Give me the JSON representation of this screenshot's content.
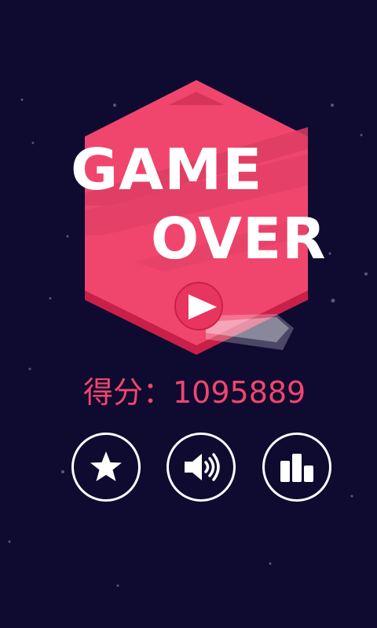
{
  "game_over": {
    "title_line_1": "GAME",
    "title_line_2": "OVER"
  },
  "score_text": "得分：1095889",
  "buttons": {
    "play_icon": "play-icon",
    "favorite_icon": "star-icon",
    "sound_icon": "speaker-icon",
    "rank_icon": "bar-chart-icon"
  },
  "colors": {
    "background": "#0f0a30",
    "hexagon": "#f0466e",
    "hexagon_dark": "#c9204a",
    "text": "#ffffff",
    "score": "#f0466e"
  }
}
